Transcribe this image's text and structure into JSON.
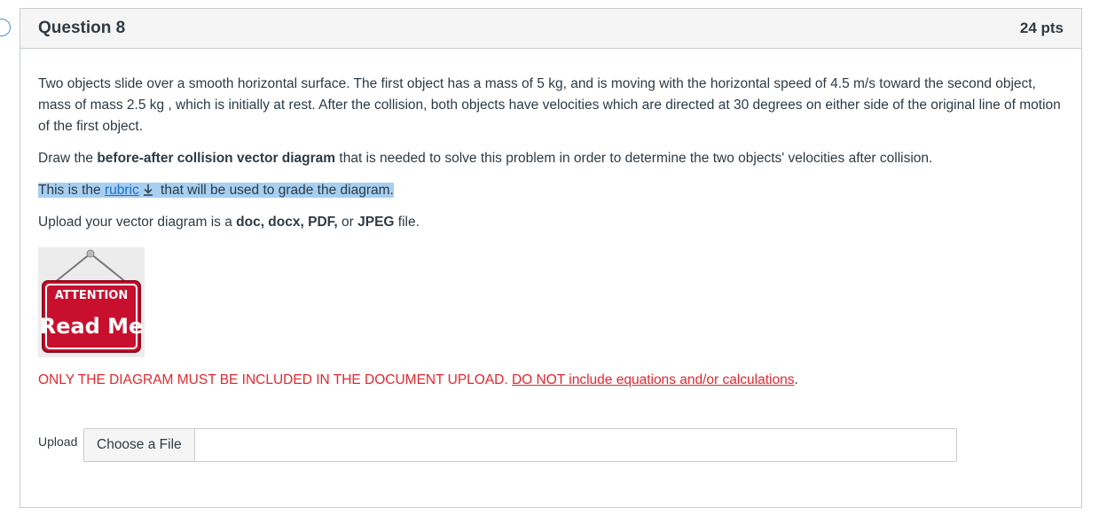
{
  "question": {
    "title": "Question 8",
    "points": "24 pts",
    "para1": "Two objects slide over a smooth horizontal surface. The first object has  a mass of  5 kg, and is moving with the horizontal speed of 4.5 m/s  toward the second object, mass of mass 2.5 kg , which is initially at rest. After the collision, both objects have velocities which are directed at 30 degrees on either side of the original line of motion of the first object.",
    "para2_pre": "Draw the ",
    "para2_bold": "before-after collision vector diagram",
    "para2_post": " that is needed to solve this problem in order to determine the two objects' velocities after collision.",
    "rubric_pre": "This is the ",
    "rubric_link": "rubric",
    "rubric_post": " that will be used to grade the diagram.",
    "upload_pre": "Upload your vector diagram is a ",
    "upload_formats": "doc, docx, PDF,",
    "upload_or": " or ",
    "upload_jpeg": "JPEG",
    "upload_post": " file.",
    "attention_top": "ATTENTION",
    "attention_main": "Read Me",
    "warning_plain": "ONLY THE DIAGRAM MUST BE INCLUDED IN THE DOCUMENT UPLOAD. ",
    "warning_underlined": "DO NOT include equations and/or calculations",
    "warning_end": ".",
    "upload_label": "Upload",
    "choose_file": "Choose a File"
  },
  "colors": {
    "warning": "#e0282f",
    "link": "#1a6fc4",
    "highlight": "#a7cff2",
    "sign_red": "#c8102e"
  }
}
